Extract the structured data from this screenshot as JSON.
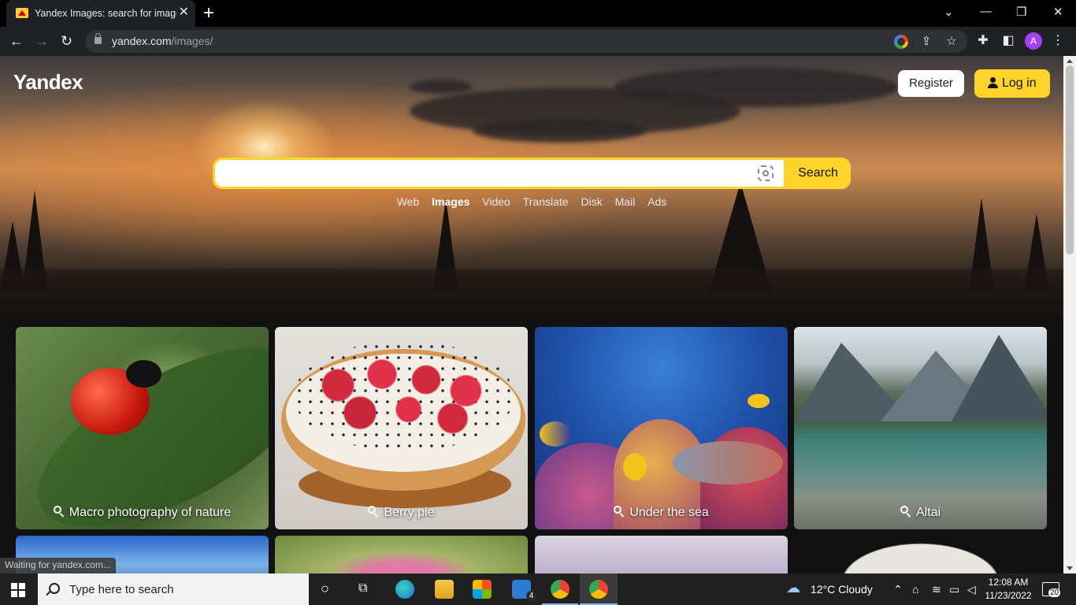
{
  "browser": {
    "tab_title": "Yandex Images: search for images",
    "tab_close": "✕",
    "new_tab": "+",
    "url_host": "yandex.com",
    "url_path": "/images/",
    "profile_initial": "A"
  },
  "header": {
    "logo": "Yandex",
    "register_label": "Register",
    "login_label": "Log in"
  },
  "search": {
    "value": "",
    "button_label": "Search"
  },
  "services": {
    "items": [
      "Web",
      "Images",
      "Video",
      "Translate",
      "Disk",
      "Mail",
      "Ads"
    ],
    "active": "Images"
  },
  "cards": [
    {
      "label": "Macro photography of nature"
    },
    {
      "label": "Berry pie"
    },
    {
      "label": "Under the sea"
    },
    {
      "label": "Altai"
    }
  ],
  "status_bar": "Waiting for yandex.com...",
  "taskbar": {
    "search_placeholder": "Type here to search",
    "mail_badge": "4",
    "weather": "12°C  Cloudy",
    "time": "12:08 AM",
    "date": "11/23/2022",
    "notifications": "20"
  },
  "colors": {
    "accent": "#fed42b",
    "chrome_bg": "#202124"
  }
}
